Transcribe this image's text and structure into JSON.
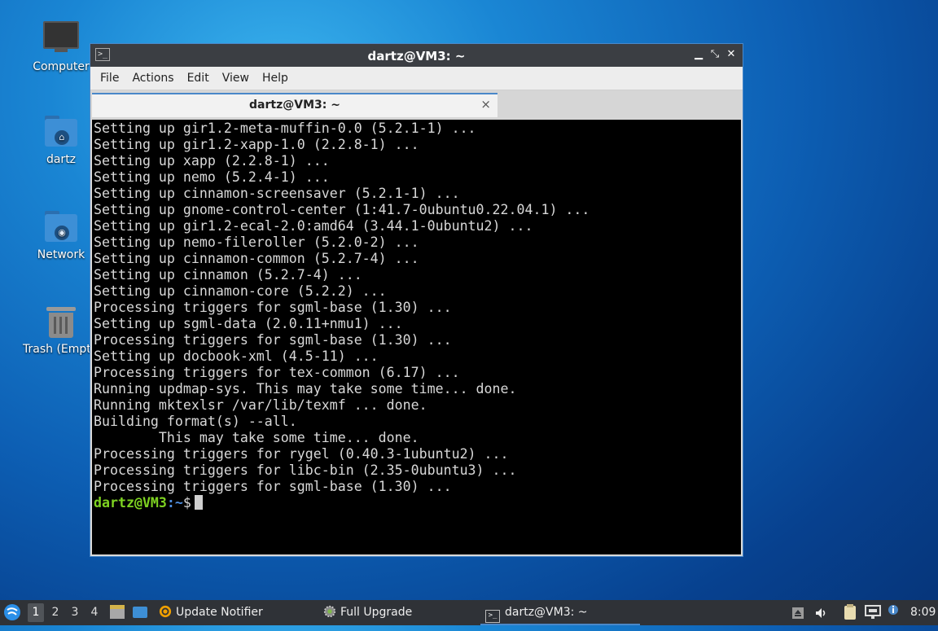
{
  "desktop": {
    "icons": [
      {
        "label": "Computer"
      },
      {
        "label": "dartz"
      },
      {
        "label": "Network"
      },
      {
        "label": "Trash (Empty)"
      }
    ]
  },
  "window": {
    "title": "dartz@VM3: ~",
    "menu": [
      "File",
      "Actions",
      "Edit",
      "View",
      "Help"
    ],
    "tab_label": "dartz@VM3: ~",
    "tab_close": "×",
    "minimize": "▁",
    "maximize": "⤡",
    "close": "✕"
  },
  "terminal": {
    "lines": [
      "Setting up gir1.2-meta-muffin-0.0 (5.2.1-1) ...",
      "Setting up gir1.2-xapp-1.0 (2.2.8-1) ...",
      "Setting up xapp (2.2.8-1) ...",
      "Setting up nemo (5.2.4-1) ...",
      "Setting up cinnamon-screensaver (5.2.1-1) ...",
      "Setting up gnome-control-center (1:41.7-0ubuntu0.22.04.1) ...",
      "Setting up gir1.2-ecal-2.0:amd64 (3.44.1-0ubuntu2) ...",
      "Setting up nemo-fileroller (5.2.0-2) ...",
      "Setting up cinnamon-common (5.2.7-4) ...",
      "Setting up cinnamon (5.2.7-4) ...",
      "Setting up cinnamon-core (5.2.2) ...",
      "Processing triggers for sgml-base (1.30) ...",
      "Setting up sgml-data (2.0.11+nmu1) ...",
      "Processing triggers for sgml-base (1.30) ...",
      "Setting up docbook-xml (4.5-11) ...",
      "Processing triggers for tex-common (6.17) ...",
      "Running updmap-sys. This may take some time... done.",
      "Running mktexlsr /var/lib/texmf ... done.",
      "Building format(s) --all.",
      "        This may take some time... done.",
      "Processing triggers for rygel (0.40.3-1ubuntu2) ...",
      "Processing triggers for libc-bin (2.35-0ubuntu3) ...",
      "Processing triggers for sgml-base (1.30) ..."
    ],
    "prompt_user": "dartz@VM3",
    "prompt_sep": ":",
    "prompt_path": "~",
    "prompt_symbol": "$"
  },
  "taskbar": {
    "workspaces": [
      "1",
      "2",
      "3",
      "4"
    ],
    "active_workspace": "1",
    "tasks": [
      {
        "label": "Update Notifier",
        "icon": "update-notifier-icon"
      },
      {
        "label": "Full Upgrade",
        "icon": "gear-icon"
      },
      {
        "label": "dartz@VM3: ~",
        "icon": "terminal-icon"
      }
    ],
    "clock": "8:09"
  }
}
